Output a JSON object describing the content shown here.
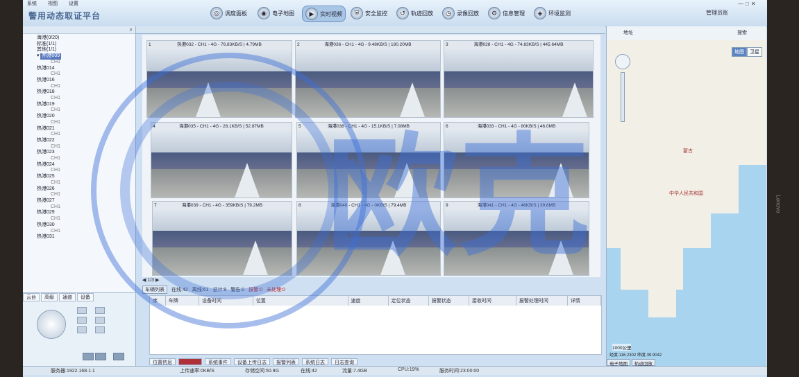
{
  "menu": [
    "系统",
    "视图",
    "设置"
  ],
  "app_title": "警用动态取证平台",
  "nav": [
    {
      "label": "调度面板",
      "icon": "dashboard-icon",
      "active": false
    },
    {
      "label": "电子地图",
      "icon": "map-icon",
      "active": false
    },
    {
      "label": "实时视频",
      "icon": "video-icon",
      "active": true
    },
    {
      "label": "安全监控",
      "icon": "shield-icon",
      "active": false
    },
    {
      "label": "轨迹回放",
      "icon": "track-icon",
      "active": false
    },
    {
      "label": "录像回放",
      "icon": "playback-icon",
      "active": false
    },
    {
      "label": "信息管理",
      "icon": "gear-icon",
      "active": false
    },
    {
      "label": "环境监测",
      "icon": "monitor-icon",
      "active": false
    }
  ],
  "user": "管理员账",
  "tree": {
    "groups": [
      {
        "label": "海港(0/20)"
      },
      {
        "label": "标准(1/1)"
      },
      {
        "label": "其他(1/1)"
      }
    ],
    "nodes": [
      {
        "label": "热港009",
        "selected": true
      },
      {
        "label": "热港014"
      },
      {
        "label": "热港016"
      },
      {
        "label": "热港018"
      },
      {
        "label": "热港019"
      },
      {
        "label": "热港020"
      },
      {
        "label": "热港021"
      },
      {
        "label": "热港022"
      },
      {
        "label": "热港023"
      },
      {
        "label": "热港024"
      },
      {
        "label": "热港025"
      },
      {
        "label": "热港026"
      },
      {
        "label": "热港027"
      },
      {
        "label": "热港029"
      },
      {
        "label": "热港030"
      },
      {
        "label": "热港031"
      }
    ],
    "channel_label": "CH1"
  },
  "ptz_tabs": [
    "云台",
    "高级",
    "通道",
    "设备"
  ],
  "tiles": [
    {
      "idx": "1",
      "label": "热港032 - CH1 - 4G - 76.83KB/S | 4.79MB"
    },
    {
      "idx": "2",
      "label": "海港036 - CH1 - 4G - 9.48KB/S | 180.20MB"
    },
    {
      "idx": "3",
      "label": "海港028 - CH1 - 4G - 74.83KB/S | 445.64MB"
    },
    {
      "idx": "4",
      "label": "海港035 - CH1 - 4G - 28.1KB/S | 52.87MB"
    },
    {
      "idx": "5",
      "label": "海港038 - CH1 - 4G - 15.1KB/S | 7.08MB"
    },
    {
      "idx": "6",
      "label": "海港033 - CH1 - 4G - 80KB/S | 46.0MB"
    },
    {
      "idx": "7",
      "label": "海港039 - CH1 - 4G - 359KB/S | 79.2MB"
    },
    {
      "idx": "8",
      "label": "海港040 - CH1 - 4G - 0KB/S | 79.4MB"
    },
    {
      "idx": "9",
      "label": "海港041 - CH1 - 4G - 46KB/S | 39.6MB"
    }
  ],
  "pager": "1/3",
  "statusbar_items": [
    "车辆列表",
    "在线:42",
    "离线:61",
    "总计:9",
    "警告:0",
    "报警:0",
    "未处理:0"
  ],
  "table_headers": [
    "序",
    "车牌",
    "设备时间",
    "位置",
    "速度",
    "定位状态",
    "报警状态",
    "接收时间",
    "报警处理时间",
    "详情"
  ],
  "bottom_tabs": [
    "位置信息",
    "",
    "系统事件",
    "设备上传日志",
    "报警列表",
    "系统日志",
    "日志查询"
  ],
  "status": {
    "server": "服务器:1922.168.1.1",
    "upload": "上传速率:0KB/S",
    "storage": "存储空间:50.9G",
    "connect": "在线:42",
    "traffic": "流量:7.4GB",
    "cpu": "CPU:19%",
    "time": "服务时间:23:00:00"
  },
  "map": {
    "tab_label": "地址",
    "search_label": "搜索",
    "switch": [
      "地图",
      "卫星"
    ],
    "switch_active": 0,
    "country_label": "中华人民共和国",
    "region_label": "蒙古",
    "scale": "1000公里",
    "coords": "经度:116.2302 纬度:39.9042",
    "tabs": [
      "电子地图",
      "轨迹回放"
    ]
  },
  "watermark": "欧克",
  "side_brand": "Lenovo"
}
